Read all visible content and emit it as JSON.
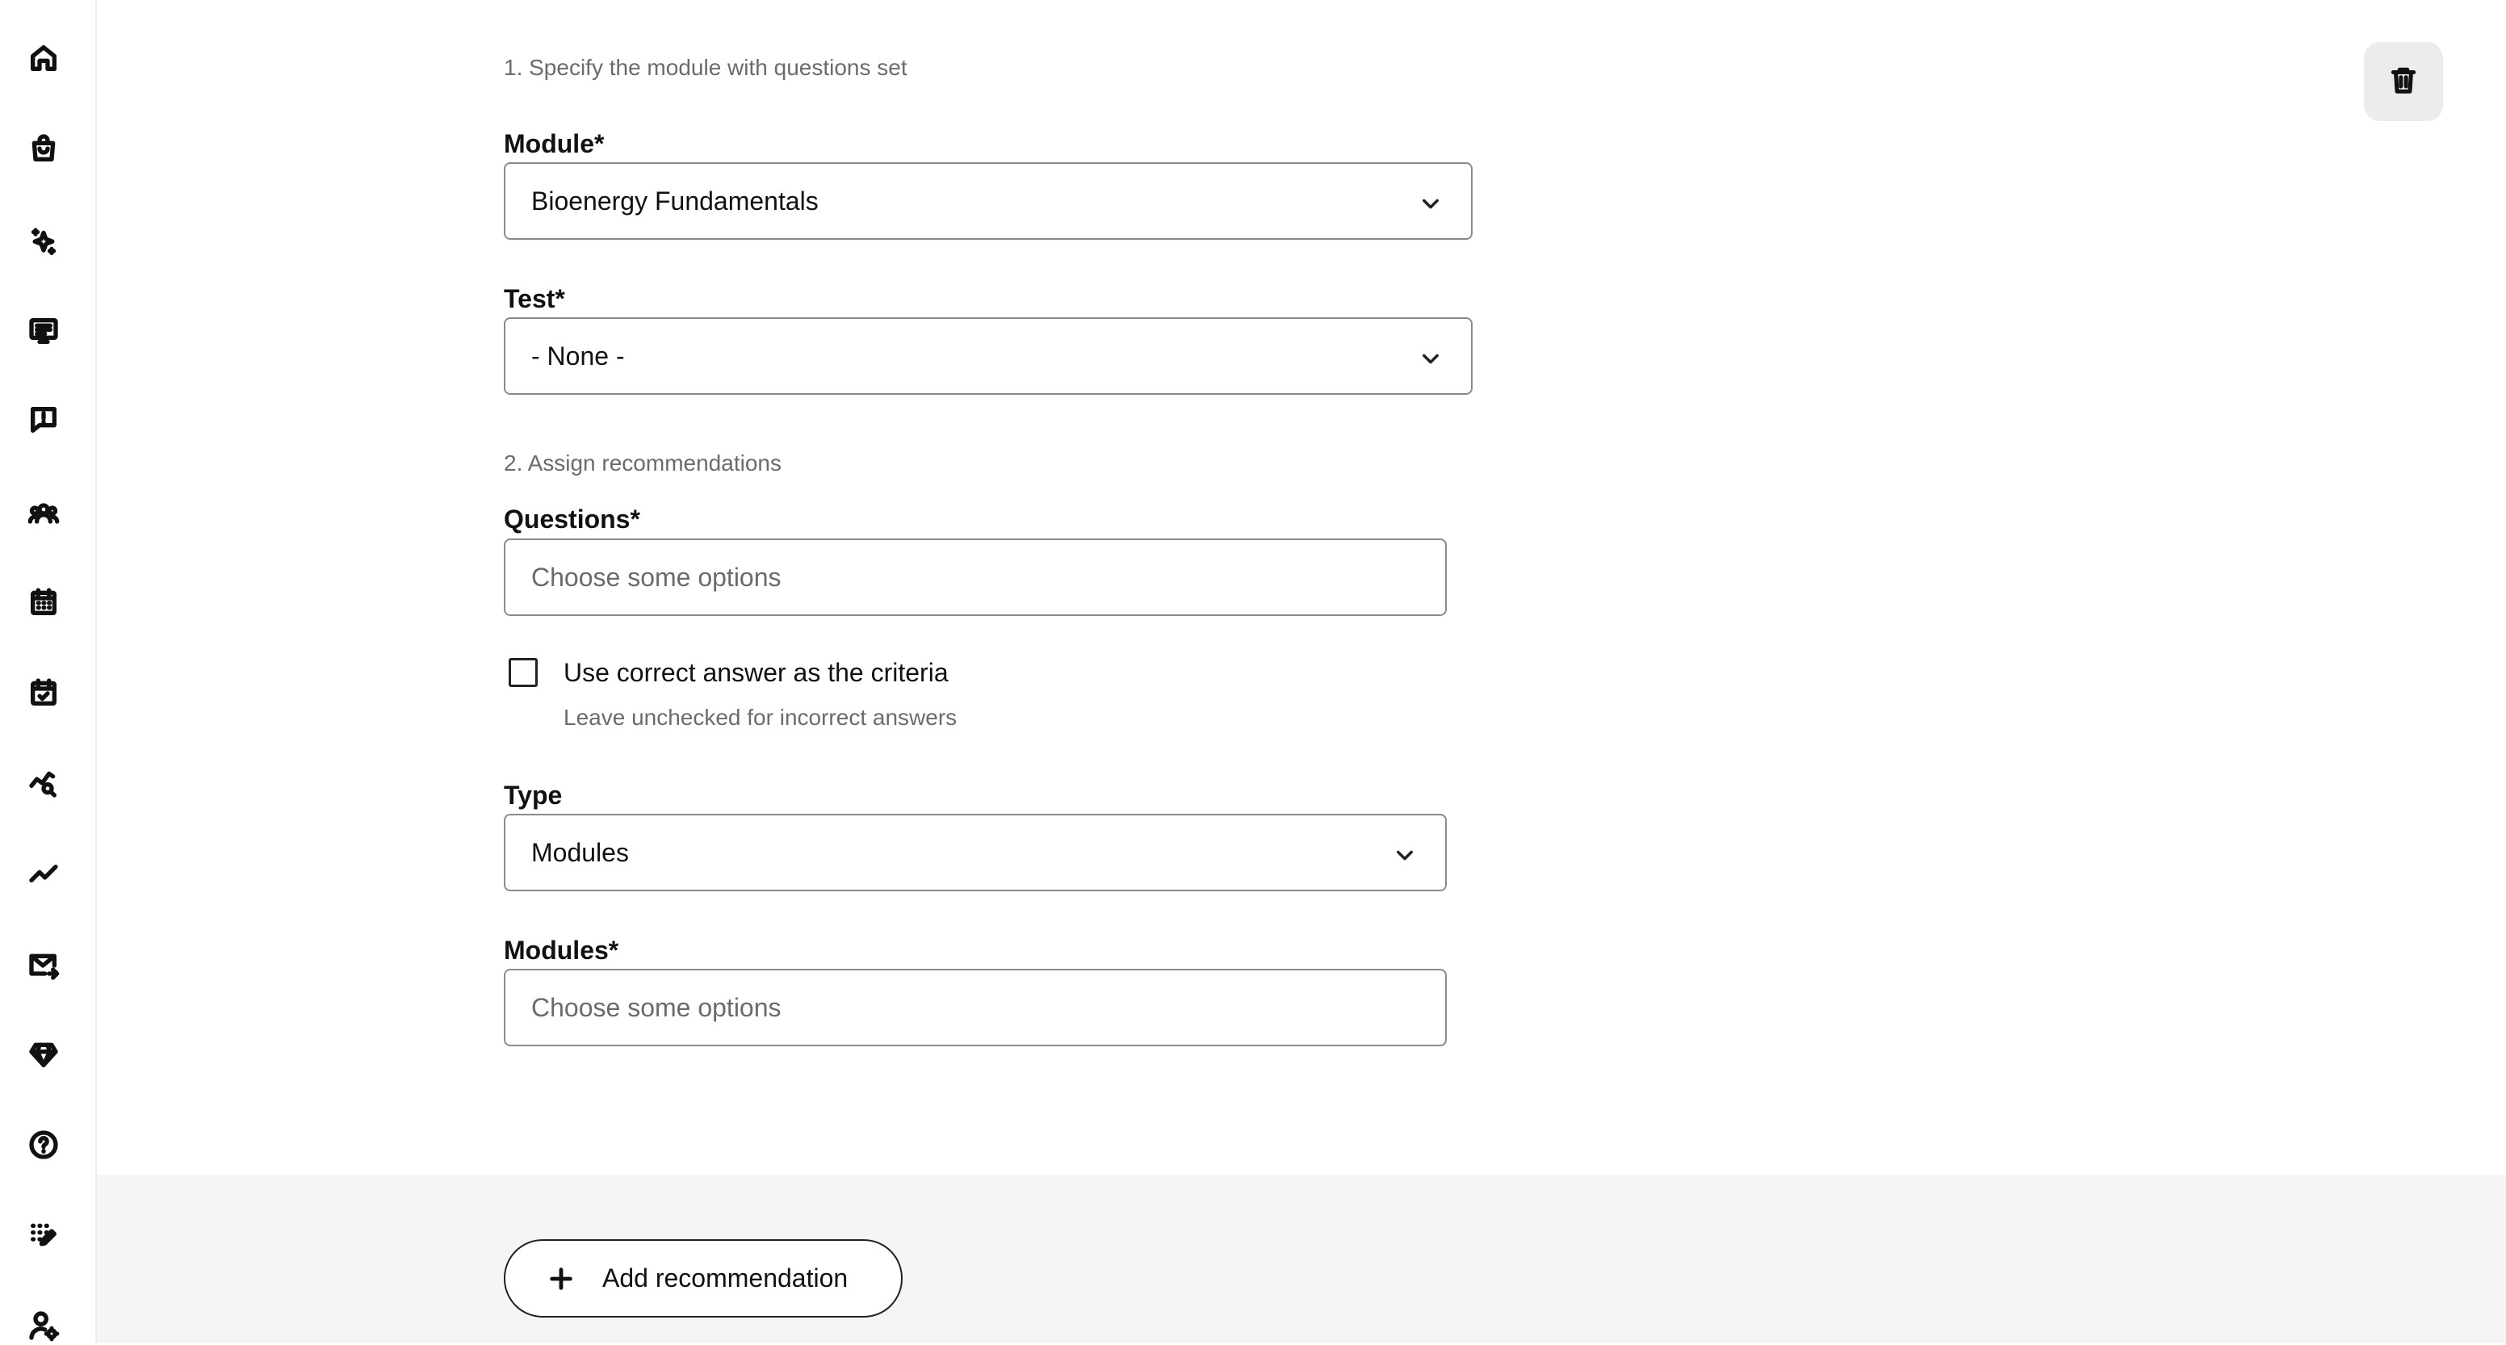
{
  "sidebar": {
    "items": [
      {
        "icon": "home-icon"
      },
      {
        "icon": "shopping-bag-icon"
      },
      {
        "icon": "sparkles-icon"
      },
      {
        "icon": "presentation-icon"
      },
      {
        "icon": "message-alert-icon"
      },
      {
        "icon": "users-icon"
      },
      {
        "icon": "calendar-icon"
      },
      {
        "icon": "calendar-check-icon"
      },
      {
        "icon": "chart-search-icon"
      },
      {
        "icon": "trend-line-icon"
      },
      {
        "icon": "mail-forward-icon"
      },
      {
        "icon": "diamond-icon"
      },
      {
        "icon": "help-circle-icon"
      },
      {
        "icon": "grid-edit-icon"
      },
      {
        "icon": "user-settings-icon"
      }
    ]
  },
  "form": {
    "step1_label": "1. Specify the module with questions set",
    "module": {
      "label": "Module*",
      "value": "Bioenergy Fundamentals"
    },
    "test": {
      "label": "Test*",
      "value": "- None -"
    },
    "step2_label": "2. Assign recommendations",
    "questions": {
      "label": "Questions*",
      "placeholder": "Choose some options"
    },
    "criteria_checkbox": {
      "label": "Use correct answer as the criteria",
      "help": "Leave unchecked for incorrect answers",
      "checked": false
    },
    "type": {
      "label": "Type",
      "value": "Modules"
    },
    "modules": {
      "label": "Modules*",
      "placeholder": "Choose some options"
    }
  },
  "actions": {
    "delete_icon": "trash-icon",
    "add_label": "Add recommendation",
    "add_icon": "plus-icon"
  }
}
